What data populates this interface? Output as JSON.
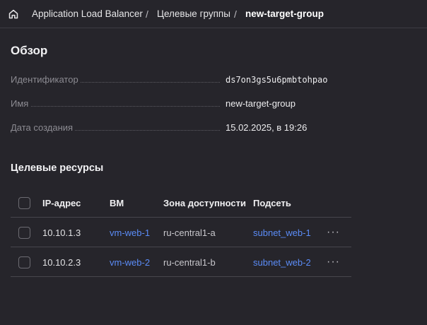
{
  "breadcrumb": {
    "items": [
      "Application Load Balancer",
      "Целевые группы",
      "new-target-group"
    ],
    "separator": "/"
  },
  "overview": {
    "title": "Обзор",
    "properties": [
      {
        "label": "Идентификатор",
        "value": "ds7on3gs5u6pmbtohpao"
      },
      {
        "label": "Имя",
        "value": "new-target-group"
      },
      {
        "label": "Дата создания",
        "value": "15.02.2025, в 19:26"
      }
    ]
  },
  "resources": {
    "title": "Целевые ресурсы",
    "columns": [
      "IP-адрес",
      "ВМ",
      "Зона доступности",
      "Подсеть"
    ],
    "rows": [
      {
        "ip": "10.10.1.3",
        "vm": "vm-web-1",
        "zone": "ru-central1-a",
        "subnet": "subnet_web-1",
        "actions": "···"
      },
      {
        "ip": "10.10.2.3",
        "vm": "vm-web-2",
        "zone": "ru-central1-b",
        "subnet": "subnet_web-2",
        "actions": "···"
      }
    ]
  },
  "colors": {
    "background": "#26252b",
    "link": "#5b8cf7",
    "divider": "#47464d"
  },
  "icons": [
    "home-icon",
    "more-icon"
  ]
}
